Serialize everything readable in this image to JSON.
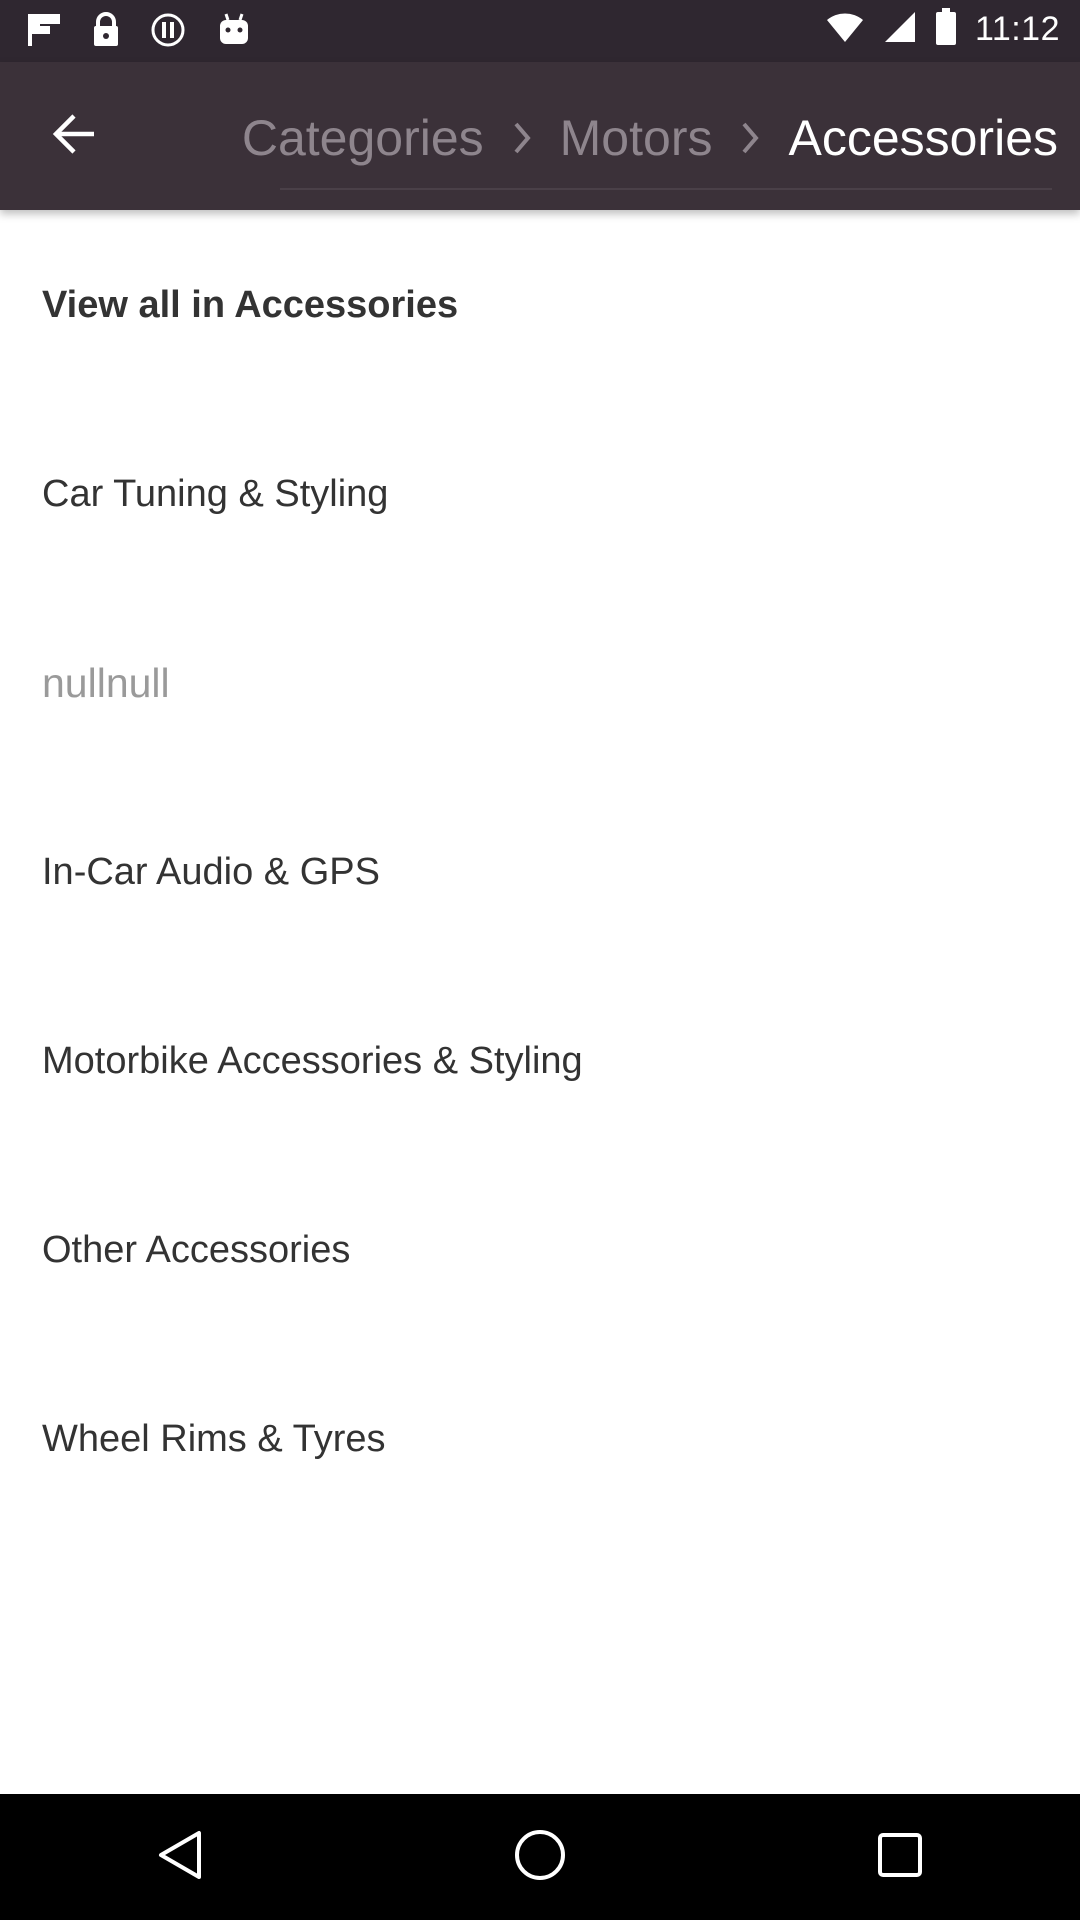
{
  "status_bar": {
    "time": "11:12",
    "icons": [
      "flipboard-icon",
      "lock-icon",
      "sync-icon",
      "android-icon",
      "wifi-icon",
      "signal-icon",
      "battery-icon"
    ]
  },
  "header": {
    "back_icon": "arrow-back-icon",
    "breadcrumb": [
      {
        "label": "Categories"
      },
      {
        "label": "Motors"
      },
      {
        "label": "Accessories"
      }
    ]
  },
  "list": {
    "items": [
      {
        "label": "View all in Accessories"
      },
      {
        "label": "Car Tuning & Styling"
      },
      {
        "label": "nullnull"
      },
      {
        "label": "In-Car Audio & GPS"
      },
      {
        "label": "Motorbike Accessories & Styling"
      },
      {
        "label": "Other Accessories"
      },
      {
        "label": "Wheel Rims & Tyres"
      }
    ]
  },
  "nav_bar": {
    "icons": [
      "back-triangle-icon",
      "home-circle-icon",
      "recents-square-icon"
    ]
  },
  "colors": {
    "status_bar": "#2f2730",
    "app_bar": "#3b3139",
    "crumb_inactive": "#8e858d",
    "crumb_active": "#ffffff"
  }
}
